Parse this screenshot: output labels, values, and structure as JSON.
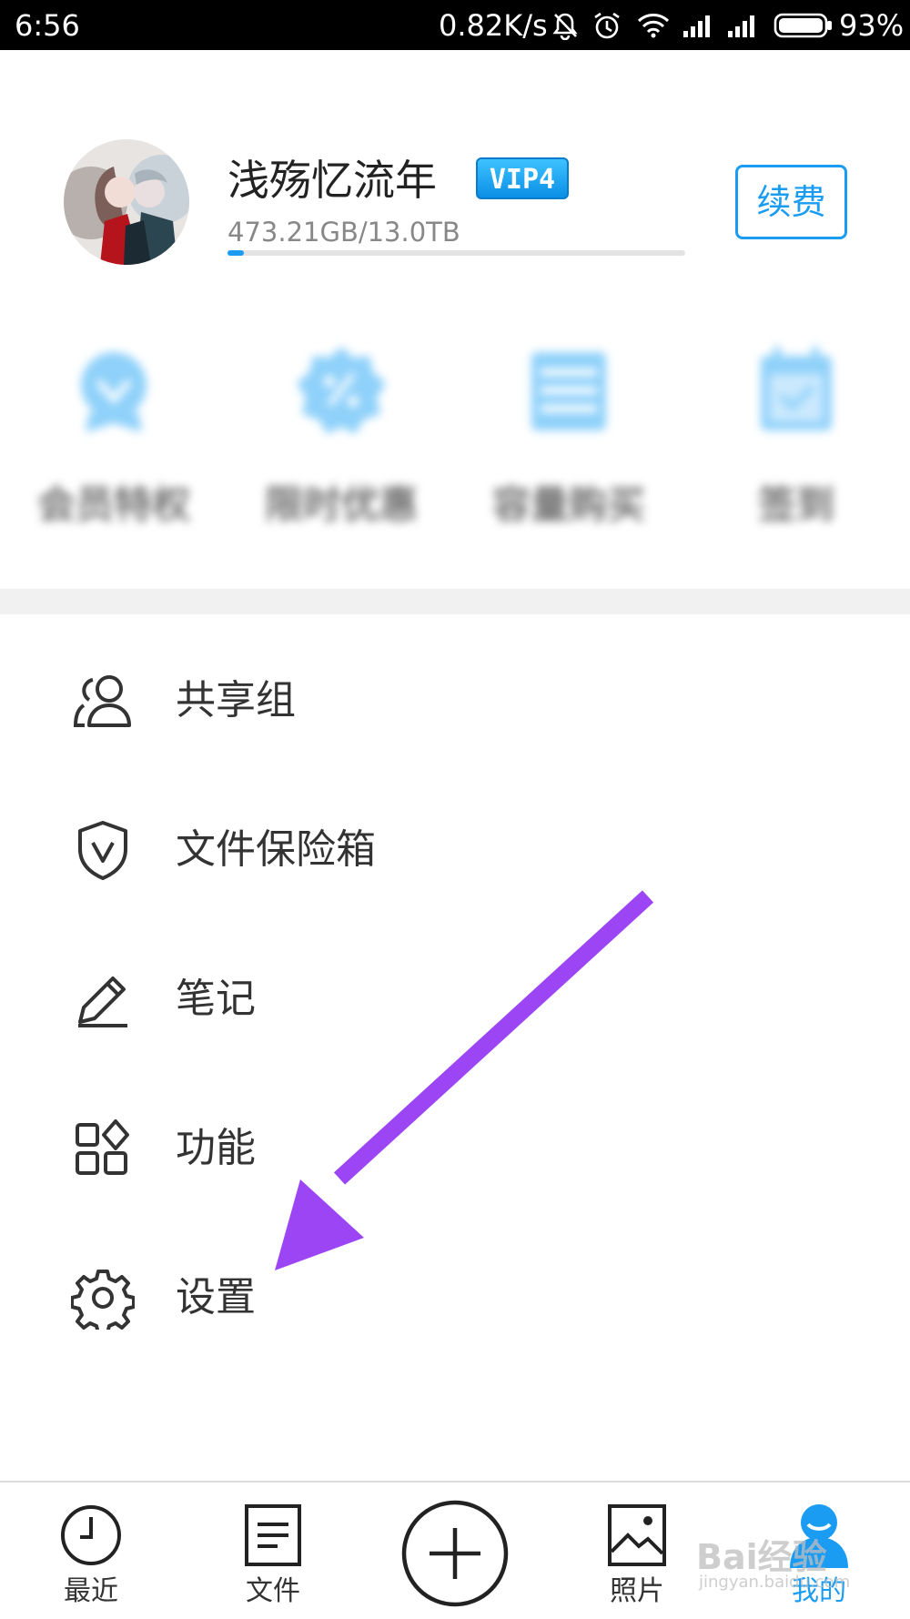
{
  "status_bar": {
    "time": "6:56",
    "network_speed": "0.82K/s",
    "battery": "93%",
    "icons": [
      "mute-icon",
      "alarm-icon",
      "wifi-icon",
      "signal-icon",
      "signal-icon",
      "battery-icon"
    ]
  },
  "profile": {
    "username": "浅殇忆流年",
    "vip_badge": "VIP4",
    "storage_text": "473.21GB/13.0TB",
    "storage_used_fraction": 0.036,
    "renew_label": "续费"
  },
  "quick_actions": [
    {
      "label": "会员特权",
      "icon": "member-badge-icon"
    },
    {
      "label": "限时优惠",
      "icon": "discount-icon"
    },
    {
      "label": "容量购买",
      "icon": "storage-icon"
    },
    {
      "label": "签到",
      "icon": "checkin-icon"
    }
  ],
  "menu": [
    {
      "label": "共享组",
      "icon": "group-icon"
    },
    {
      "label": "文件保险箱",
      "icon": "shield-icon"
    },
    {
      "label": "笔记",
      "icon": "pencil-icon"
    },
    {
      "label": "功能",
      "icon": "grid-icon"
    },
    {
      "label": "设置",
      "icon": "gear-icon"
    }
  ],
  "tabs": [
    {
      "label": "最近",
      "icon": "clock-icon"
    },
    {
      "label": "文件",
      "icon": "document-icon"
    },
    {
      "label": "",
      "icon": "add-icon"
    },
    {
      "label": "照片",
      "icon": "image-icon"
    },
    {
      "label": "我的",
      "icon": "user-icon",
      "active": true
    }
  ],
  "watermark": {
    "text": "Bai经验",
    "sub": "jingyan.baidu.com"
  },
  "colors": {
    "accent": "#1a9cf3",
    "arrow": "#9b45f5",
    "text": "#333333"
  }
}
